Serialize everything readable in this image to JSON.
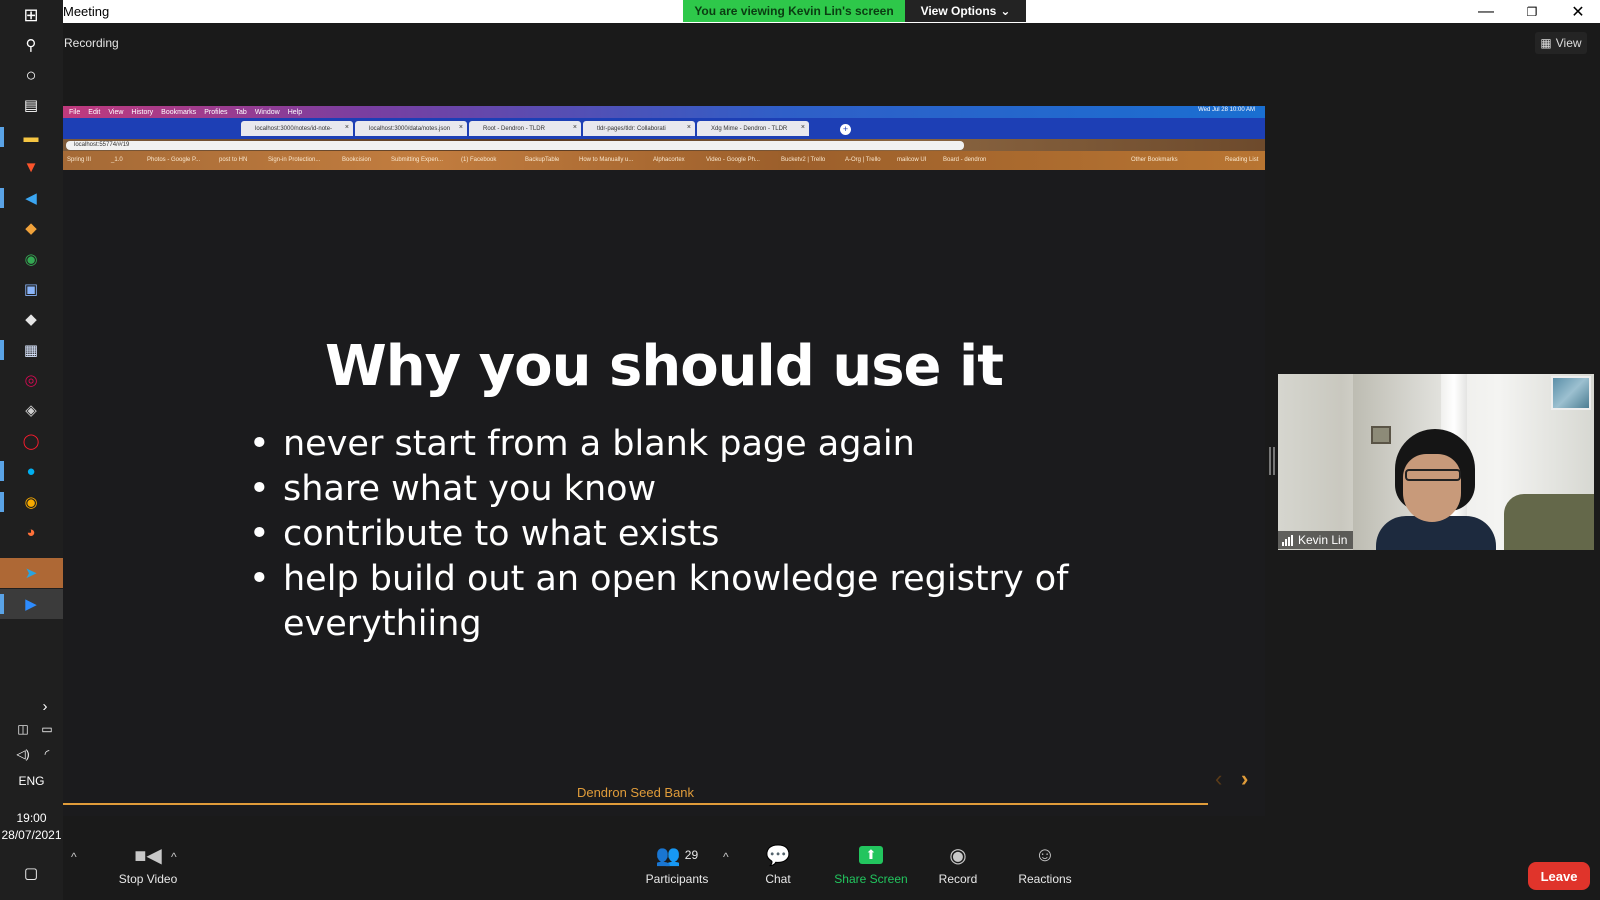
{
  "window": {
    "title": "Meeting",
    "viewing_banner": "You are viewing Kevin Lin's screen",
    "view_options": "View Options",
    "recording": "Recording",
    "view_button": "View"
  },
  "taskbar": {
    "language": "ENG",
    "time": "19:00",
    "date": "28/07/2021",
    "icons": [
      "windows-start-icon",
      "search-icon",
      "cortana-icon",
      "task-view-icon",
      "file-explorer-icon",
      "brave-icon",
      "vscode-icon",
      "git-icon",
      "chrome-icon",
      "save-icon",
      "app-icon",
      "notepad-icon",
      "debian-icon",
      "tag-icon",
      "opera-icon",
      "skype-icon",
      "chrome-canary-icon",
      "firefox-icon",
      "telegram-icon",
      "zoom-icon"
    ]
  },
  "browser": {
    "menu": [
      "File",
      "Edit",
      "View",
      "History",
      "Bookmarks",
      "Profiles",
      "Tab",
      "Window",
      "Help"
    ],
    "clock": "Wed Jul 28  10:00 AM",
    "tabs": [
      "localhost:3000/notes/id-note-",
      "localhost:3000/data/notes.json",
      "Root - Dendron - TLDR",
      "tldr-pages/tldr: Collaborati",
      "Xdg Mime - Dendron - TLDR"
    ],
    "address": "localhost:55774/#/19",
    "bookmarks": [
      "Spring III",
      "_1.0",
      "Photos - Google P...",
      "post to HN",
      "Sign-in Protection...",
      "Bookcision",
      "Submitting Expen...",
      "(1) Facebook",
      "BackupTable",
      "How to Manually u...",
      "Alphacortex",
      "Video - Google Ph...",
      "Bucketv2 | Trello",
      "A-Org | Trello",
      "mailcow UI",
      "Board - dendron",
      "Other Bookmarks",
      "Reading List"
    ]
  },
  "slide": {
    "title": "Why you should use it",
    "bullets": [
      "never start from a blank page again",
      "share what you know",
      "contribute to what exists",
      "help build out an open knowledge registry of everythiing"
    ],
    "footer": "Dendron Seed Bank",
    "accent_color": "#e09c3a"
  },
  "video": {
    "participant_name": "Kevin Lin"
  },
  "toolbar": {
    "stop_video": "Stop Video",
    "participants": "Participants",
    "participants_count": "29",
    "chat": "Chat",
    "share_screen": "Share Screen",
    "record": "Record",
    "reactions": "Reactions",
    "leave": "Leave",
    "share_color": "#22c55e",
    "leave_color": "#e0342b"
  }
}
